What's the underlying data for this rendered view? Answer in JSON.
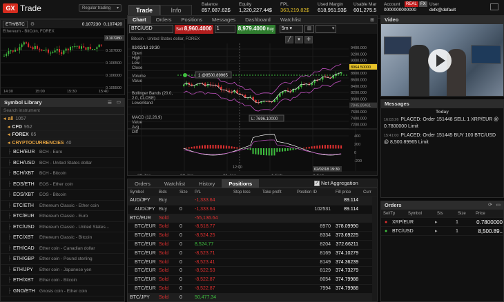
{
  "topbar": {
    "logo_mark": "GX",
    "logo_text": "Trade",
    "mode": "Regular trading",
    "tab_trade": "Trade",
    "tab_info": "Info",
    "stats": [
      {
        "label": "Balance",
        "value": "857,087.62$",
        "color": "#ffffff"
      },
      {
        "label": "Equity",
        "value": "1,220,227.44$",
        "color": "#ffffff"
      },
      {
        "label": "FPL",
        "value": "363,219.82$",
        "color": "#e6c229"
      },
      {
        "label": "Used Margin",
        "value": "618,951.93$",
        "color": "#ffffff"
      },
      {
        "label": "Usable Mar",
        "value": "601,275.5",
        "color": "#ffffff"
      }
    ],
    "account_label": "Account",
    "account_value": "0000000000000",
    "real_badge": "REAL",
    "fx_badge": "FX",
    "user_label": "User",
    "user_value": "dxfx@default"
  },
  "mini_chart": {
    "symbol": "ETH/BTC",
    "bid": "0.107230",
    "ask": "0.107420",
    "subtitle": "Ethereum - BitCoin, FOREX",
    "price_labels": [
      "0.107280",
      "0.107000",
      "0.106500",
      "0.106000",
      "0.105500"
    ],
    "time_labels": [
      "14:30",
      "15:00",
      "15:30",
      "15:40"
    ]
  },
  "library": {
    "title": "Symbol Library",
    "search_placeholder": "Search instrument",
    "groups": [
      {
        "name": "all",
        "count": "1057",
        "color": "#e0a040"
      },
      {
        "name": "CFD",
        "count": "952",
        "color": "#dddddd"
      },
      {
        "name": "FOREX",
        "count": "65",
        "color": "#dddddd"
      },
      {
        "name": "CRYPTOCURRENCIES",
        "count": "40",
        "color": "#e0a040"
      }
    ],
    "items": [
      {
        "sym": "BCH/EUR",
        "desc": "BCH - Euro"
      },
      {
        "sym": "BCH/USD",
        "desc": "BCH - United States dollar"
      },
      {
        "sym": "BCH/XBT",
        "desc": "BCH - Bitcoin"
      },
      {
        "sym": "EOS/ETH",
        "desc": "EOS - Ether coin"
      },
      {
        "sym": "EOS/XBT",
        "desc": "EOS - Bitcoin"
      },
      {
        "sym": "ETC/ETH",
        "desc": "Ethereum Classic - Ether coin"
      },
      {
        "sym": "ETC/EUR",
        "desc": "Ethereum Classic - Euro"
      },
      {
        "sym": "ETC/USD",
        "desc": "Ethereum Classic - United States..."
      },
      {
        "sym": "ETC/XBT",
        "desc": "Ethereum Classic - Bitcoin"
      },
      {
        "sym": "ETH/CAD",
        "desc": "Ether coin - Canadian dollar"
      },
      {
        "sym": "ETH/GBP",
        "desc": "Ether coin - Pound sterling"
      },
      {
        "sym": "ETH/JPY",
        "desc": "Ether coin - Japanese yen"
      },
      {
        "sym": "ETH/XBT",
        "desc": "Ether coin - Bitcoin"
      },
      {
        "sym": "GNO/ETH",
        "desc": "Gnosis coin - Ether coin"
      }
    ]
  },
  "chart": {
    "tabs": [
      "Chart",
      "Orders",
      "Positions",
      "Messages",
      "Dashboard",
      "Watchlist"
    ],
    "symbol": "BTC/USD",
    "sell_label": "Sell",
    "sell_price": "8,960.4000",
    "qty": "1",
    "buy_price": "8,979.4000",
    "buy_label": "Buy",
    "interval": "5m",
    "subtitle": "Bitcoin - United States dollar, FOREX",
    "legend": [
      "02/02/18 19:30",
      "Open",
      "High",
      "Low",
      "Close",
      "Volume",
      "Value"
    ],
    "indicator1": "Bollinger Bands (20.0, 2.0, CLOSE)",
    "indicator1_b": "LowerBand",
    "indicator2": "MACD (12,26,9)",
    "indicator2_lines": [
      "Value",
      "Avg",
      "Diff"
    ],
    "order_marker": "1 @8500.89965",
    "low_marker": "L: 7696.10000",
    "y_labels": [
      "9400.000",
      "9200.000",
      "9000.000",
      "8964.50000",
      "8800.000",
      "8600.000",
      "8400.000",
      "8200.000",
      "8000.000",
      "7845.89461",
      "7600.000",
      "7400.000",
      "7200.000"
    ],
    "macd_labels": [
      "400",
      "200",
      "0",
      "-200"
    ],
    "x_labels": [
      "29 Jan",
      "30 Jan",
      "31 Jan",
      "1 Feb",
      "2 Feb"
    ],
    "x_cursor": "02/02/18 19:30",
    "x_mid": "12:00"
  },
  "positions": {
    "tabs": [
      "Orders",
      "Watchlist",
      "History",
      "Positions"
    ],
    "net_label": "Net Aggregation",
    "columns": [
      "Symbol",
      "Bids",
      "Size",
      "P/L",
      "Stop loss",
      "Take profit",
      "Position ID",
      "Fill price",
      "Curr"
    ],
    "rows": [
      {
        "sym": "AUD/JPY",
        "side": "Buy",
        "size": "",
        "pl": "-1,333.64",
        "id": "",
        "fill": "89.114",
        "group": true
      },
      {
        "sym": "AUD/JPY",
        "side": "Buy",
        "size": "0",
        "pl": "-1,333.64",
        "id": "102531",
        "fill": "89.114",
        "group": false
      },
      {
        "sym": "BTC/EUR",
        "side": "Sold",
        "size": "",
        "pl": "-55,136.64",
        "id": "",
        "fill": "",
        "group": true
      },
      {
        "sym": "BTC/EUR",
        "side": "Sold",
        "size": "0",
        "pl": "-8,518.77",
        "id": "8970",
        "fill": "378.09990",
        "group": false
      },
      {
        "sym": "BTC/EUR",
        "side": "Sold",
        "size": "0",
        "pl": "-8,524.25",
        "id": "8334",
        "fill": "373.69225",
        "group": false
      },
      {
        "sym": "BTC/EUR",
        "side": "Sold",
        "size": "0",
        "pl": "8,524.77",
        "id": "8204",
        "fill": "372.66211",
        "group": false
      },
      {
        "sym": "BTC/EUR",
        "side": "Sold",
        "size": "0",
        "pl": "-8,523.71",
        "id": "8169",
        "fill": "374.10279",
        "group": false
      },
      {
        "sym": "BTC/EUR",
        "side": "Sold",
        "size": "0",
        "pl": "-8,523.41",
        "id": "8149",
        "fill": "374.36239",
        "group": false
      },
      {
        "sym": "BTC/EUR",
        "side": "Sold",
        "size": "0",
        "pl": "-8,522.53",
        "id": "8129",
        "fill": "374.73279",
        "group": false
      },
      {
        "sym": "BTC/EUR",
        "side": "Sold",
        "size": "0",
        "pl": "-8,522.87",
        "id": "8054",
        "fill": "374.79988",
        "group": false
      },
      {
        "sym": "BTC/EUR",
        "side": "Sold",
        "size": "0",
        "pl": "-8,522.87",
        "id": "7994",
        "fill": "374.79988",
        "group": false
      },
      {
        "sym": "BTC/JPY",
        "side": "Sold",
        "size": "0",
        "pl": "50,477.34",
        "id": "",
        "fill": "",
        "group": true
      }
    ]
  },
  "video": {
    "title": "Video"
  },
  "messages": {
    "title": "Messages",
    "day": "Today",
    "items": [
      {
        "time": "16:03:26",
        "text": "PLACED: Order 151448 SELL 1 XRP/EUR @ 0.7800000 Limit"
      },
      {
        "time": "15:41:00",
        "text": "PLACED: Order 151445 BUY 100 BTC/USD @ 8,500.89965 Limit"
      }
    ]
  },
  "orders": {
    "title": "Orders",
    "columns": [
      "Sel/Tp",
      "Symbol",
      "Sts",
      "Size",
      "Price"
    ],
    "rows": [
      {
        "sym": "XRP/EUR",
        "size": "1",
        "price": "0.7800000",
        "color": "#e03030"
      },
      {
        "sym": "BTC/USD",
        "size": "1",
        "price": "8,500.89..",
        "color": "#3fbf3f"
      }
    ]
  }
}
